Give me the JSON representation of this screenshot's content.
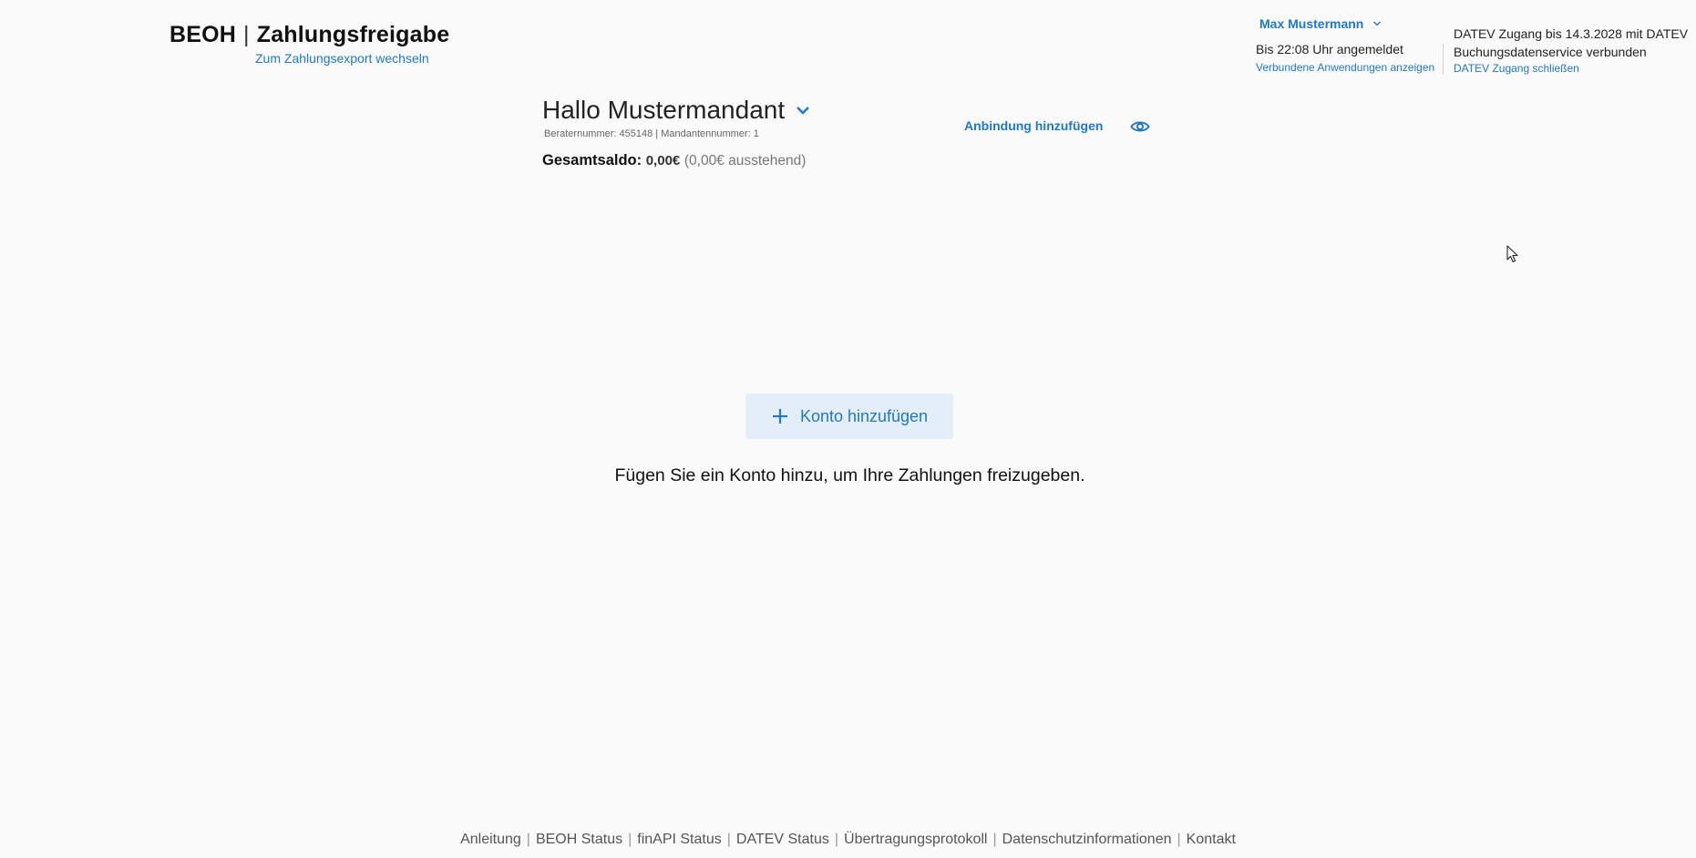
{
  "header": {
    "brand": "BEOH",
    "separator": "|",
    "app_title": "Zahlungsfreigabe",
    "switch_link": "Zum Zahlungsexport wechseln"
  },
  "user": {
    "name": "Max Mustermann",
    "status": "Bis 22:08 Uhr angemeldet",
    "connected_apps_link": "Verbundene Anwendungen anzeigen"
  },
  "datev": {
    "status_line1": "DATEV Zugang bis 14.3.2028 mit DATEV",
    "status_line2": "Buchungsdatenservice verbunden",
    "close_link": "DATEV Zugang schließen"
  },
  "greeting": {
    "title": "Hallo Mustermandant",
    "meta": "Beraternummer: 455148 | Mandantennummer: 1",
    "saldo_label": "Gesamtsaldo:",
    "saldo_amount": "0,00€",
    "saldo_pending": "(0,00€ ausstehend)"
  },
  "actions": {
    "add_connection": "Anbindung hinzufügen",
    "add_account": "Konto hinzufügen"
  },
  "empty_hint": "Fügen Sie ein Konto hinzu, um Ihre Zahlungen freizugeben.",
  "footer": {
    "links": [
      "Anleitung",
      "BEOH Status",
      "finAPI Status",
      "DATEV Status",
      "Übertragungsprotokoll",
      "Datenschutzinformationen",
      "Kontakt"
    ]
  },
  "icons": {
    "user_menu": "chevron-down-icon",
    "mandant_menu": "chevron-down-icon",
    "visibility": "eye-icon",
    "add": "plus-icon"
  },
  "colors": {
    "accent": "#1f78c8",
    "button_bg": "#e3eef8",
    "background": "#fafafa"
  }
}
